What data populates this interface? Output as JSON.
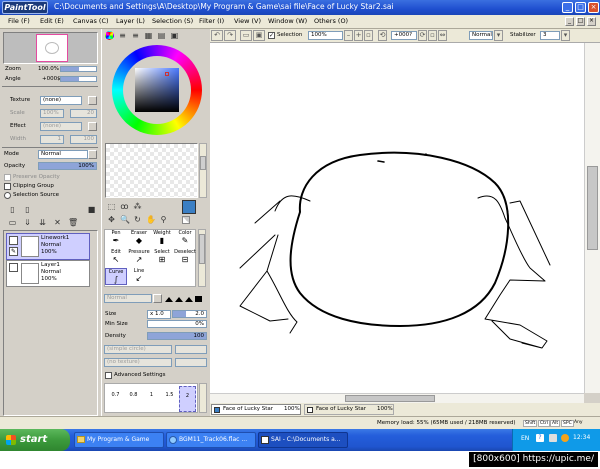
{
  "window": {
    "app_logo": "PaintTool SAI",
    "title": "C:\\Documents and Settings\\A\\Desktop\\My Program & Game\\sai file\\Face of Lucky Star2.sai",
    "controls": {
      "minimize": "_",
      "maximize": "□",
      "close": "×"
    },
    "inner_controls": {
      "minimize": "_",
      "maximize": "□",
      "close": "×"
    }
  },
  "menu": [
    "File (F)",
    "Edit (E)",
    "Canvas (C)",
    "Layer (L)",
    "Selection (S)",
    "Filter (I)",
    "View (V)",
    "Window (W)",
    "Others (O)"
  ],
  "navigator": {
    "zoom_label": "Zoom",
    "zoom_value": "100.0%",
    "angle_label": "Angle",
    "angle_value": "+000$"
  },
  "texture": {
    "texture_label": "Texture",
    "texture_value": "(none)",
    "scale_label": "Scale",
    "scale_value": "100%",
    "scale_num": "20",
    "effect_label": "Effect",
    "effect_value": "(none)",
    "width_label": "Width",
    "width_value": "1",
    "width_num": "100"
  },
  "layer_props": {
    "mode_label": "Mode",
    "mode_value": "Normal",
    "opacity_label": "Opacity",
    "opacity_value": "100%",
    "preserve_opacity": "Preserve Opacity",
    "clipping_group": "Clipping Group",
    "selection_source": "Selection Source"
  },
  "layers": [
    {
      "name": "Linework1",
      "mode": "Normal",
      "opacity": "100%"
    },
    {
      "name": "Layer1",
      "mode": "Normal",
      "opacity": "100%"
    }
  ],
  "tools": {
    "row1": [
      "Pen",
      "Eraser",
      "Weight",
      "Color"
    ],
    "row2": [
      "Edit",
      "Pressure",
      "Select",
      "Deselect"
    ],
    "row3": [
      "Curve",
      "Line"
    ]
  },
  "brush": {
    "mode_value": "Normal",
    "size_label": "Size",
    "size_mult": "x 1.0",
    "size_value": "2.0",
    "min_size_label": "Min Size",
    "min_size_value": "0%",
    "density_label": "Density",
    "density_value": "100",
    "shape_value": "(simple circle)",
    "texture_value": "(no texture)",
    "advanced_label": "Advanced Settings",
    "size_presets": [
      "0.7",
      "0.8",
      "1",
      "1.5",
      "2"
    ]
  },
  "canvas_toolbar": {
    "selection_label": "Selection",
    "zoom_value": "100%",
    "angle_value": "+000?",
    "mode_value": "Normal",
    "stabilizer_label": "Stabilizer",
    "stabilizer_value": "3"
  },
  "canvas_tabs": [
    {
      "name": "Face of Lucky Star",
      "zoom": "100%"
    },
    {
      "name": "Face of Lucky Star",
      "zoom": "100%"
    }
  ],
  "status": {
    "memory": "Memory load: 55% (65MB used / 218MB reserved)",
    "keys": [
      "Shift",
      "Ctrl",
      "Alt",
      "SPC",
      "Any"
    ]
  },
  "taskbar": {
    "start_label": "start",
    "items": [
      "My Program & Game",
      "BGM11_Track06.flac ...",
      "SAI - C:\\Documents a..."
    ],
    "tray_lang": "EN",
    "clock": "12:34"
  },
  "footer_text": "[800x600] https://upic.me/",
  "colors": {
    "titlebar": "#245edb",
    "taskbar": "#245edb",
    "start_green": "#3c9a3c",
    "selected_layer": "#cfcfff",
    "primary_color": "#3b7fc4"
  }
}
